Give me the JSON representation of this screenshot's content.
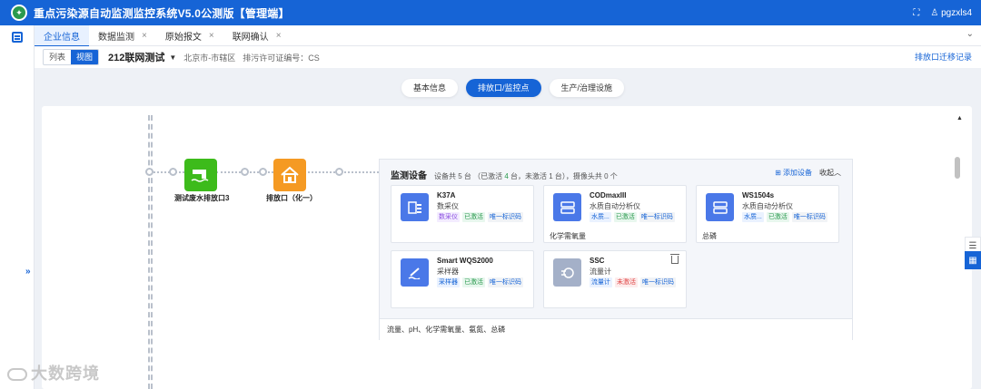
{
  "app": {
    "title": "重点污染源自动监测监控系统V5.0公测版【管理端】",
    "user": "pgzxls4"
  },
  "tabs": [
    {
      "label": "企业信息",
      "active": true,
      "closable": false
    },
    {
      "label": "数据监测",
      "active": false,
      "closable": true
    },
    {
      "label": "原始报文",
      "active": false,
      "closable": true
    },
    {
      "label": "联网确认",
      "active": false,
      "closable": true
    }
  ],
  "subheader": {
    "view_list": "列表",
    "view_graph": "视图",
    "station": "212联网测试",
    "region": "北京市-市辖区",
    "permit": "排污许可证编号：CS",
    "outlet_log": "排放口迁移记录"
  },
  "section_tabs": [
    {
      "label": "基本信息",
      "active": false
    },
    {
      "label": "排放口/监控点",
      "active": true
    },
    {
      "label": "生产/治理设施",
      "active": false
    }
  ],
  "flow": {
    "node1": {
      "label": "测试废水排放口3",
      "icon": "wastewater-icon"
    },
    "node2": {
      "label": "排放口（化一）",
      "icon": "outlet-house-icon"
    }
  },
  "devices": {
    "title": "监测设备",
    "summary_prefix": "设备共 5 台 （已激活 ",
    "summary_active": "4",
    "summary_mid": " 台，未激活 1 台），摄像头共 0 个",
    "add_label": "添加设备",
    "collapse_label": "收起",
    "items": [
      {
        "name": "K37A",
        "type": "数采仪",
        "tags": [
          "数采仪",
          "已激活",
          "唯一标识码"
        ],
        "foot": "",
        "icon": "data-collector-icon"
      },
      {
        "name": "CODmaxIII",
        "type": "水质自动分析仪",
        "tags": [
          "水质...",
          "已激活",
          "唯一标识码"
        ],
        "foot": "化学需氧量",
        "icon": "analyzer-icon"
      },
      {
        "name": "WS1504s",
        "type": "水质自动分析仪",
        "tags": [
          "水质...",
          "已激活",
          "唯一标识码"
        ],
        "foot": "总磷",
        "icon": "analyzer-icon"
      },
      {
        "name": "Smart WQS2000",
        "type": "采样器",
        "tags": [
          "采样器",
          "已激活",
          "唯一标识码"
        ],
        "foot": "",
        "icon": "sampler-icon"
      },
      {
        "name": "SSC",
        "type": "流量计",
        "tags": [
          "流量计",
          "未激活",
          "唯一标识码"
        ],
        "foot": "",
        "icon": "flowmeter-icon"
      }
    ],
    "params": "流量、pH、化学需氧量、氨氮、总磷"
  },
  "watermark": "大数跨境"
}
